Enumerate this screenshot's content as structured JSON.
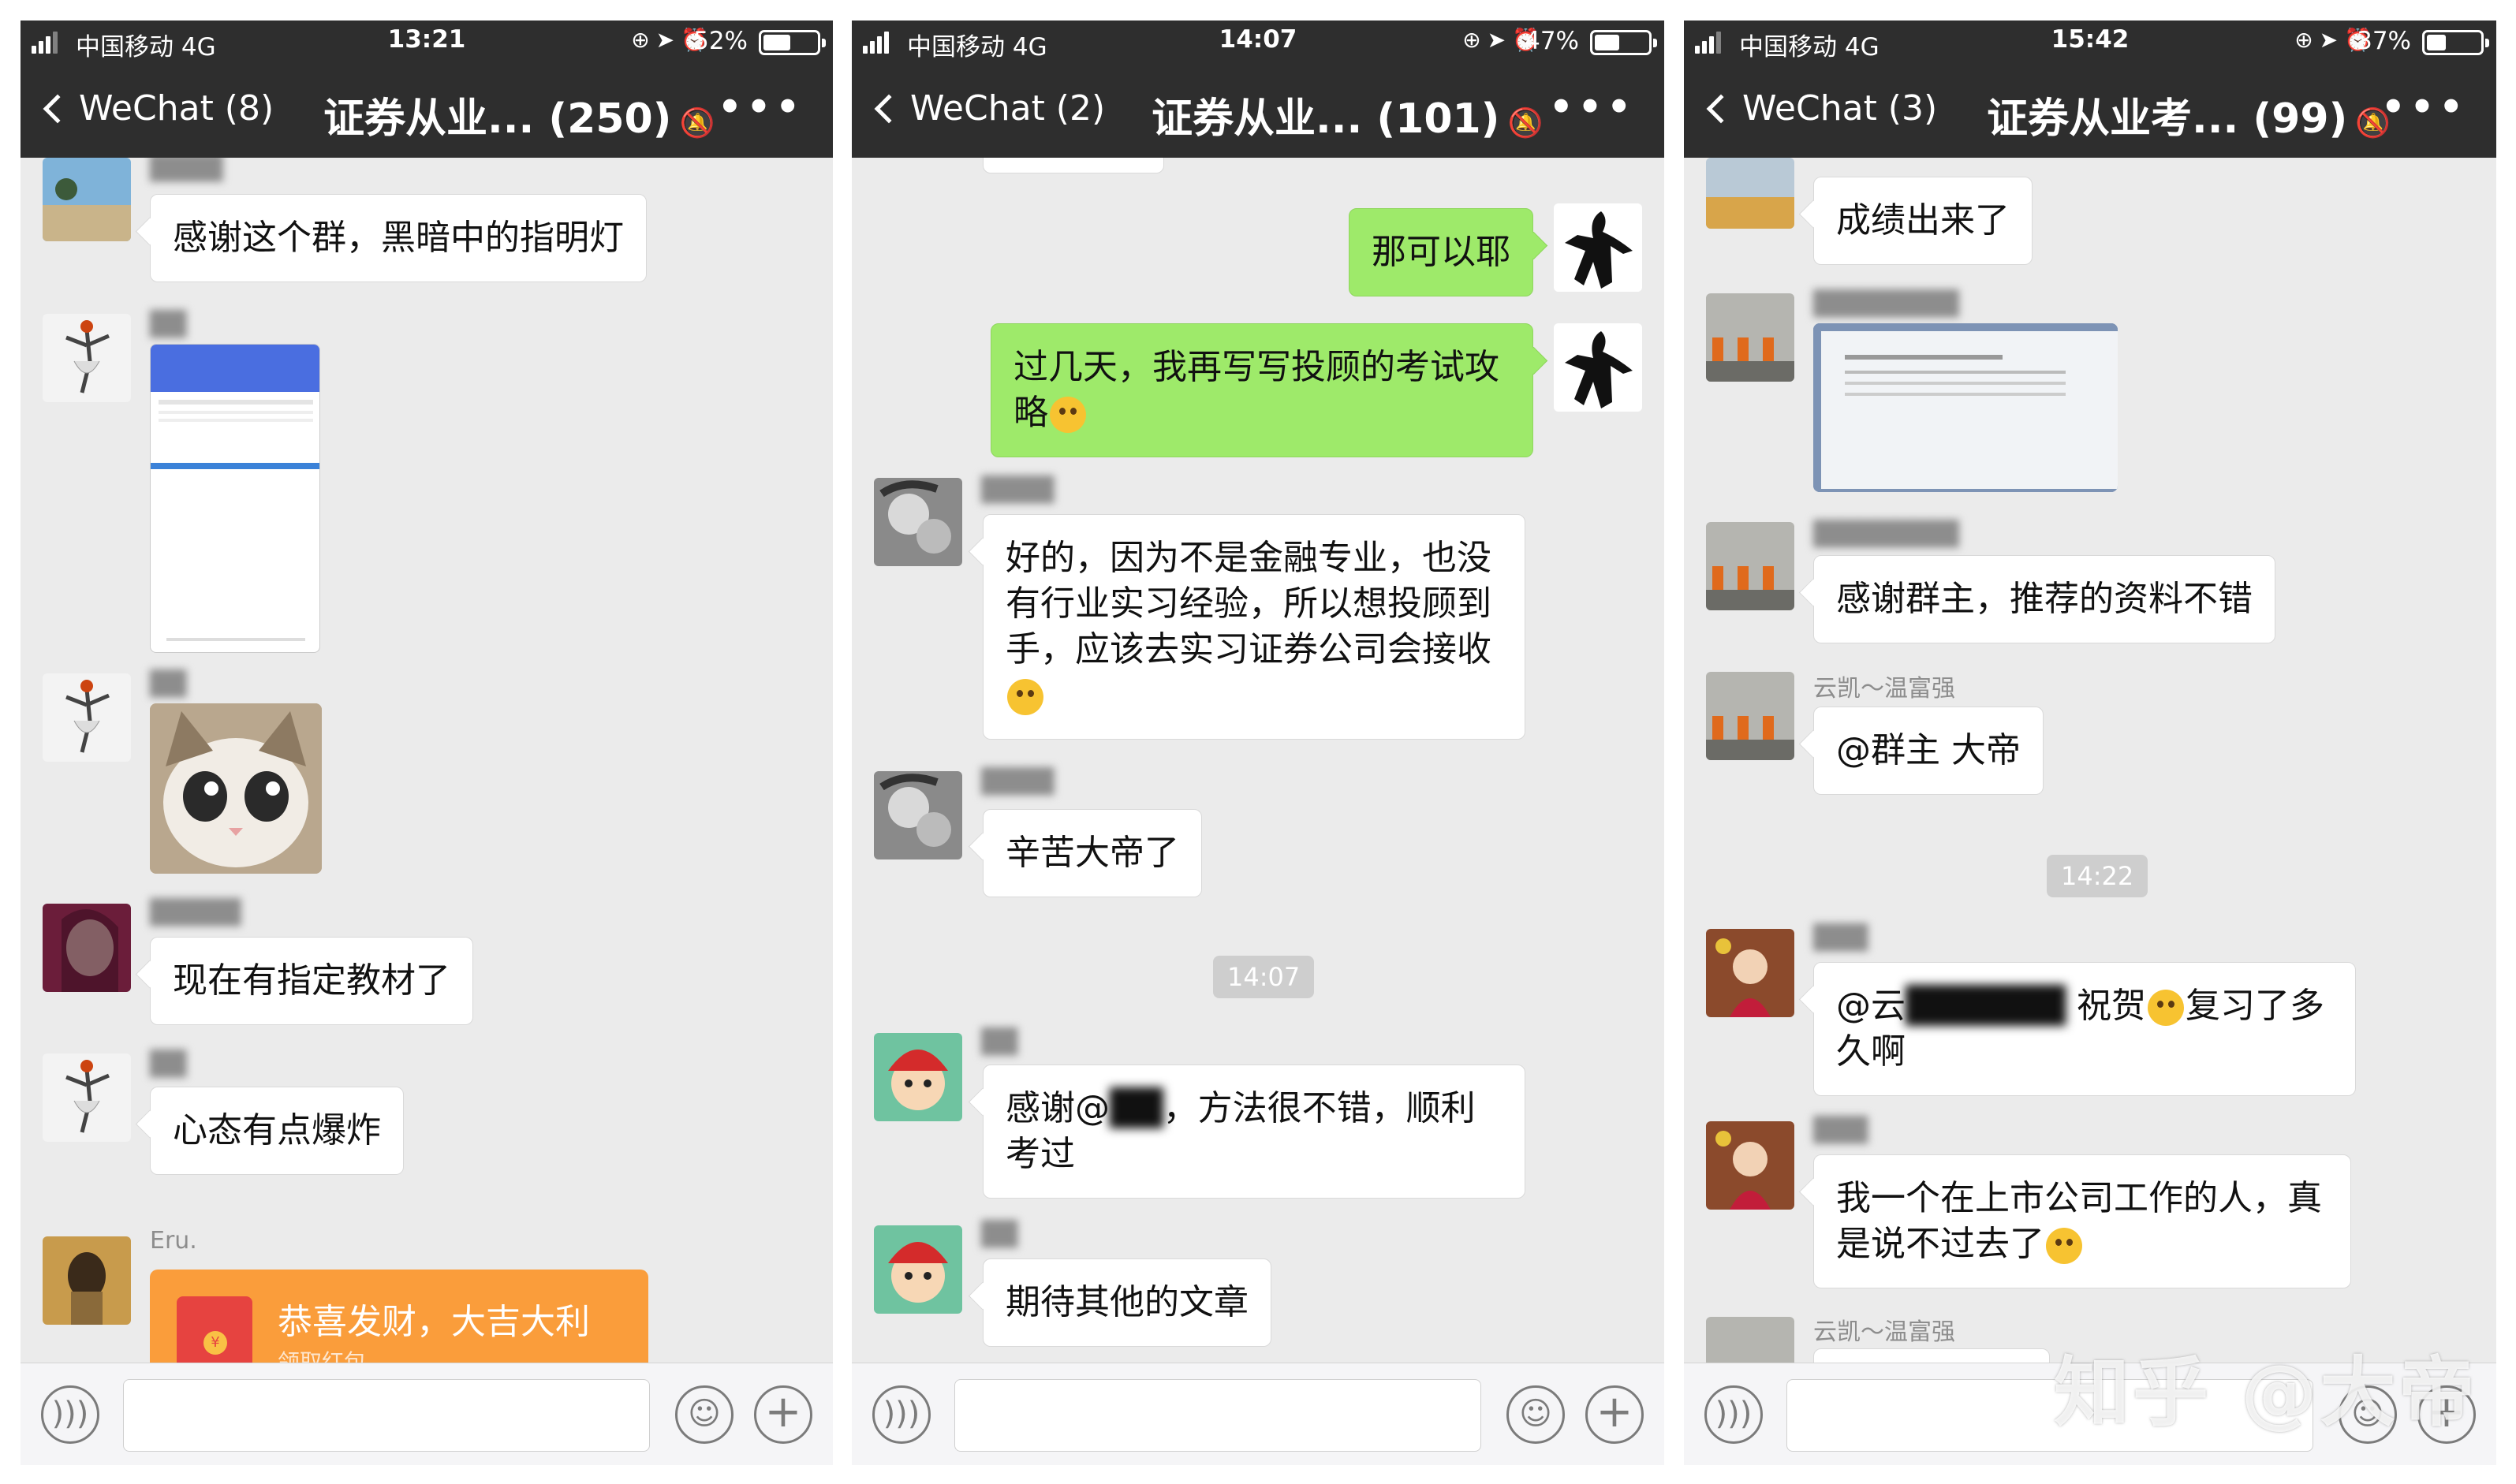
{
  "colors": {
    "navbar": "#2e2e2e",
    "chat_bg": "#ebebeb",
    "bubble_white": "#ffffff",
    "bubble_green": "#9eea6a",
    "red_packet": "#fa9d3b"
  },
  "screens": [
    {
      "status": {
        "carrier": "中国移动 4G",
        "time": "13:21",
        "battery": "52%",
        "battery_level": 0.52
      },
      "nav": {
        "back_label": "WeChat (8)",
        "title": "证券从业... (250)"
      },
      "messages": {
        "m1": "感谢这个群，黑暗中的指明灯",
        "m2": "现在有指定教材了",
        "m3": "心态有点爆炸",
        "redpacket_sender": "Eru.",
        "redpacket_title": "恭喜发财，大吉大利",
        "redpacket_sub": "领取红包"
      }
    },
    {
      "status": {
        "carrier": "中国移动 4G",
        "time": "14:07",
        "battery": "47%",
        "battery_level": 0.47
      },
      "nav": {
        "back_label": "WeChat (2)",
        "title": "证券从业... (101)"
      },
      "messages": {
        "m1": "那可以耶",
        "m2": "过几天，我再写写投顾的考试攻略",
        "m3": "好的，因为不是金融专业，也没有行业实习经验，所以想投顾到手，应该去实习证券公司会接收",
        "m4": "辛苦大帝了",
        "time_divider": "14:07",
        "m5_prefix": "感谢@",
        "m5_suffix": "，方法很不错，顺利考过",
        "m6": "期待其他的文章"
      }
    },
    {
      "status": {
        "carrier": "中国移动 4G",
        "time": "15:42",
        "battery": "37%",
        "battery_level": 0.37
      },
      "nav": {
        "back_label": "WeChat (3)",
        "title": "证券从业考... (99)"
      },
      "messages": {
        "m1": "成绩出来了",
        "m2": "感谢群主，推荐的资料不错",
        "nick_m3": "云凯～温富强",
        "m3": "@群主 大帝",
        "time_divider": "14:22",
        "m4_prefix": "@云",
        "m4_suffix": "祝贺",
        "m4_end": "复习了多久啊",
        "m5": "我一个在上市公司工作的人，真是说不过去了",
        "nick_m6": "云凯～温富强"
      }
    }
  ],
  "watermark": "知乎 @大帝"
}
